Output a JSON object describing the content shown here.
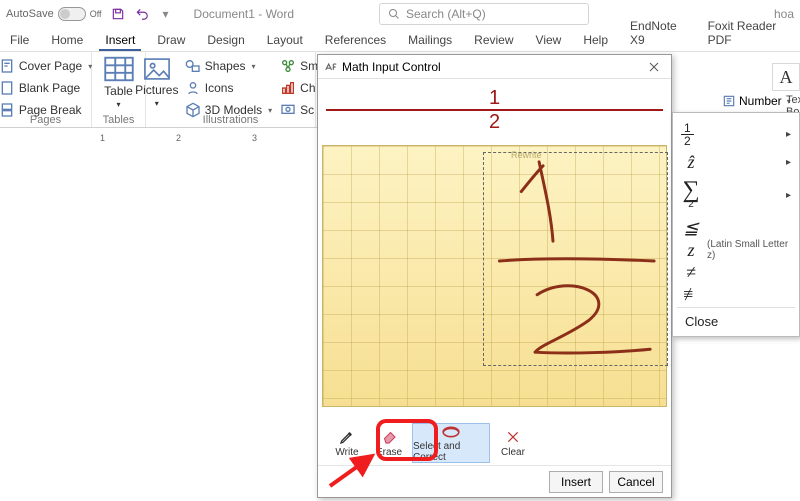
{
  "titlebar": {
    "autosave": "AutoSave",
    "autosave_state": "Off",
    "doctitle": "Document1 - Word",
    "search_placeholder": "Search (Alt+Q)",
    "user": "hoa"
  },
  "tabs": [
    "File",
    "Home",
    "Insert",
    "Draw",
    "Design",
    "Layout",
    "References",
    "Mailings",
    "Review",
    "View",
    "Help",
    "EndNote X9",
    "Foxit Reader PDF"
  ],
  "active_tab": "Insert",
  "ribbon": {
    "pages": {
      "label": "Pages",
      "cover": "Cover Page",
      "blank": "Blank Page",
      "break": "Page Break"
    },
    "tables": {
      "label": "Tables",
      "table": "Table"
    },
    "illustrations": {
      "label": "Illustrations",
      "pictures": "Pictures",
      "shapes": "Shapes",
      "icons": "Icons",
      "models": "3D Models",
      "smart": "Sm",
      "chart": "Ch",
      "screenshot": "Sc"
    },
    "number": "Number",
    "textbox": "Tex\nBox"
  },
  "ruler_ticks": [
    "1",
    "2",
    "3"
  ],
  "dialog": {
    "title": "Math Input Control",
    "preview": {
      "numerator": "1",
      "denominator": "2"
    },
    "rewrite_label": "Rewrite",
    "tools": {
      "write": "Write",
      "erase": "Erase",
      "select_correct": "Select and Correct",
      "clear": "Clear"
    },
    "insert": "Insert",
    "cancel": "Cancel"
  },
  "dropdown": {
    "items": [
      {
        "sym": "½",
        "submenu": true,
        "type": "fraction"
      },
      {
        "sym": "Ẑ",
        "submenu": true
      },
      {
        "sym": "∑₂",
        "submenu": true,
        "type": "sum"
      },
      {
        "sym": "≦",
        "submenu": false
      },
      {
        "sym": "z",
        "desc": "(Latin Small Letter z)",
        "submenu": false
      },
      {
        "sym": "≠",
        "submenu": false
      },
      {
        "sym": "≇",
        "submenu": false
      }
    ],
    "close": "Close"
  }
}
